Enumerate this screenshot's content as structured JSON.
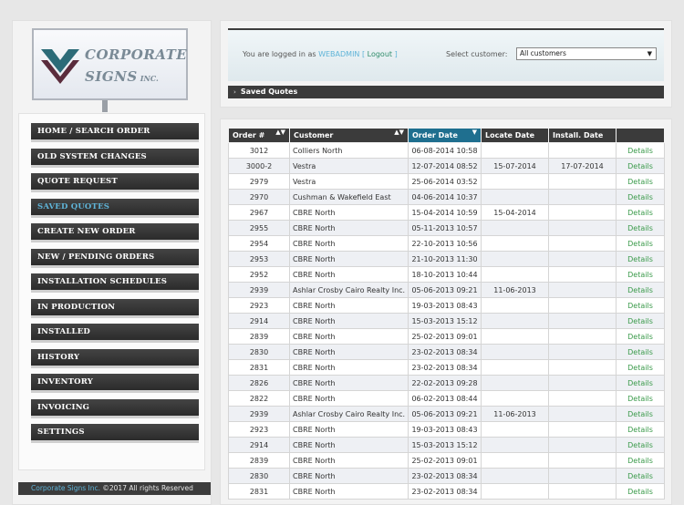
{
  "logo": {
    "line1": "CORPORATE",
    "line2": "SIGNS",
    "inc": "INC."
  },
  "nav": {
    "items": [
      {
        "label": "HOME / SEARCH ORDER",
        "active": false
      },
      {
        "label": "OLD SYSTEM CHANGES",
        "active": false
      },
      {
        "label": "QUOTE REQUEST",
        "active": false
      },
      {
        "label": "SAVED QUOTES",
        "active": true
      },
      {
        "label": "CREATE NEW ORDER",
        "active": false
      },
      {
        "label": "NEW / PENDING ORDERS",
        "active": false
      },
      {
        "label": "INSTALLATION SCHEDULES",
        "active": false
      },
      {
        "label": "IN PRODUCTION",
        "active": false
      },
      {
        "label": "INSTALLED",
        "active": false
      },
      {
        "label": "HISTORY",
        "active": false
      },
      {
        "label": "INVENTORY",
        "active": false
      },
      {
        "label": "INVOICING",
        "active": false
      },
      {
        "label": "SETTINGS",
        "active": false
      }
    ]
  },
  "footer": {
    "brand": "Corporate Signs Inc.",
    "rest": " ©2017 All rights Reserved"
  },
  "header": {
    "logged_prefix": "You are logged in as ",
    "username": "WEBADMIN",
    "logout": "Logout",
    "select_label": "Select customer:",
    "customer_value": "All customers",
    "section_title": "Saved Quotes"
  },
  "table": {
    "columns": [
      "Order #",
      "Customer",
      "Order Date",
      "Locate Date",
      "Install. Date",
      ""
    ],
    "details_label": "Details",
    "rows": [
      [
        "3012",
        "Colliers North",
        "06-08-2014 10:58",
        "",
        ""
      ],
      [
        "3000-2",
        "Vestra",
        "12-07-2014 08:52",
        "15-07-2014",
        "17-07-2014"
      ],
      [
        "2979",
        "Vestra",
        "25-06-2014 03:52",
        "",
        ""
      ],
      [
        "2970",
        "Cushman & Wakefield East",
        "04-06-2014 10:37",
        "",
        ""
      ],
      [
        "2967",
        "CBRE North",
        "15-04-2014 10:59",
        "15-04-2014",
        ""
      ],
      [
        "2955",
        "CBRE North",
        "05-11-2013 10:57",
        "",
        ""
      ],
      [
        "2954",
        "CBRE North",
        "22-10-2013 10:56",
        "",
        ""
      ],
      [
        "2953",
        "CBRE North",
        "21-10-2013 11:30",
        "",
        ""
      ],
      [
        "2952",
        "CBRE North",
        "18-10-2013 10:44",
        "",
        ""
      ],
      [
        "2939",
        "Ashlar Crosby Cairo Realty Inc.",
        "05-06-2013 09:21",
        "11-06-2013",
        ""
      ],
      [
        "2923",
        "CBRE North",
        "19-03-2013 08:43",
        "",
        ""
      ],
      [
        "2914",
        "CBRE North",
        "15-03-2013 15:12",
        "",
        ""
      ],
      [
        "2839",
        "CBRE North",
        "25-02-2013 09:01",
        "",
        ""
      ],
      [
        "2830",
        "CBRE North",
        "23-02-2013 08:34",
        "",
        ""
      ],
      [
        "2831",
        "CBRE North",
        "23-02-2013 08:34",
        "",
        ""
      ],
      [
        "2826",
        "CBRE North",
        "22-02-2013 09:28",
        "",
        ""
      ],
      [
        "2822",
        "CBRE North",
        "06-02-2013 08:44",
        "",
        ""
      ],
      [
        "2939",
        "Ashlar Crosby Cairo Realty Inc.",
        "05-06-2013 09:21",
        "11-06-2013",
        ""
      ],
      [
        "2923",
        "CBRE North",
        "19-03-2013 08:43",
        "",
        ""
      ],
      [
        "2914",
        "CBRE North",
        "15-03-2013 15:12",
        "",
        ""
      ],
      [
        "2839",
        "CBRE North",
        "25-02-2013 09:01",
        "",
        ""
      ],
      [
        "2830",
        "CBRE North",
        "23-02-2013 08:34",
        "",
        ""
      ],
      [
        "2831",
        "CBRE North",
        "23-02-2013 08:34",
        "",
        ""
      ]
    ]
  }
}
